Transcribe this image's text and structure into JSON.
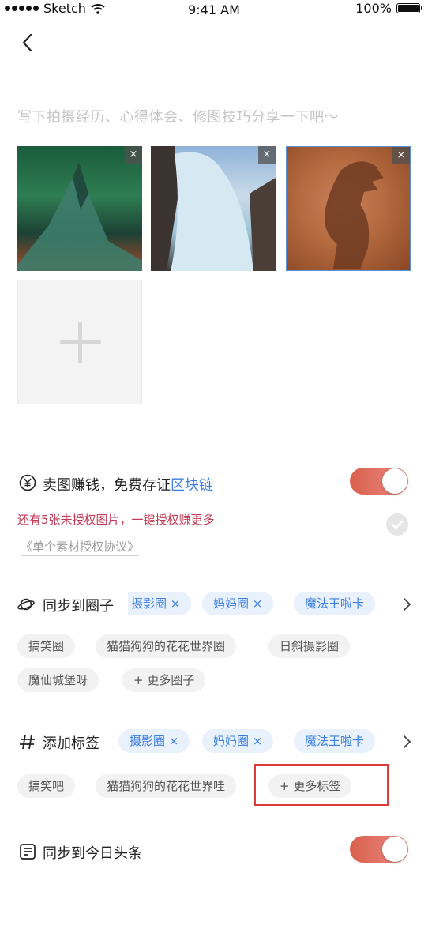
{
  "status_bar": {
    "carrier": "Sketch",
    "time": "9:41 AM",
    "battery": "100%"
  },
  "compose": {
    "placeholder": "写下拍摄经历、心得体会、修图技巧分享一下吧～"
  },
  "photos": {
    "remove_label": "×"
  },
  "sell": {
    "title": "卖图赚钱，免费存证",
    "title_link": "区块链",
    "promo": "还有5张未授权图片，一键授权赚更多",
    "agreement": "《单个素材授权协议》",
    "toggle_on": true
  },
  "circles": {
    "title": "同步到圈子",
    "selected": [
      "摄影圈 ×",
      "妈妈圈 ×",
      "魔法王啦卡"
    ],
    "suggestions": [
      "搞笑圈",
      "猫猫狗狗的花花世界圈",
      "日斜摄影圈",
      "魔仙城堡呀"
    ],
    "more": "+ 更多圈子"
  },
  "tags": {
    "title": "添加标签",
    "selected": [
      "摄影圈 ×",
      "妈妈圈 ×",
      "魔法王啦卡"
    ],
    "suggestions": [
      "搞笑吧",
      "猫猫狗狗的花花世界哇"
    ],
    "more": "+ 更多标签"
  },
  "toutiao": {
    "title": "同步到今日头条",
    "toggle_on": true
  },
  "colors": {
    "accent": "#3d7fe0",
    "toggle": "#e0675a",
    "promo": "#c23a55",
    "highlight": "#e03b3b"
  }
}
